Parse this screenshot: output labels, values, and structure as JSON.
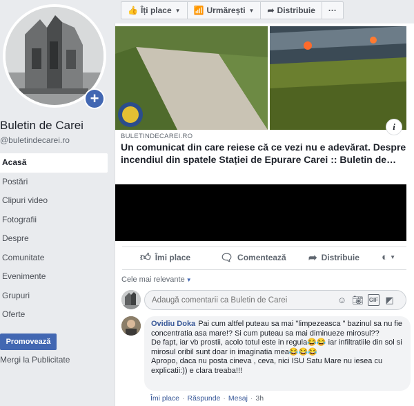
{
  "page": {
    "name": "Buletin de Carei",
    "handle": "@buletindecarei.ro"
  },
  "nav": [
    {
      "label": "Acasă",
      "active": true
    },
    {
      "label": "Postări"
    },
    {
      "label": "Clipuri video"
    },
    {
      "label": "Fotografii"
    },
    {
      "label": "Despre"
    },
    {
      "label": "Comunitate"
    },
    {
      "label": "Evenimente"
    },
    {
      "label": "Grupuri"
    },
    {
      "label": "Oferte"
    }
  ],
  "promote_label": "Promovează",
  "publicity_label": "Mergi la Publicitate",
  "action_bar": {
    "like": "Îți place",
    "follow": "Urmărești",
    "share": "Distribuie",
    "more": "···"
  },
  "link": {
    "domain": "BULETINDECAREI.RO",
    "title": "Un comunicat din care reiese că ce vezi nu e adevărat. Despre incendiul din spatele Stației de Epurare Carei :: Buletin de…"
  },
  "reactions": {
    "like": "Îmi place",
    "comment": "Comentează",
    "share": "Distribuie"
  },
  "comments": {
    "sort_label": "Cele mai relevante",
    "input_placeholder": "Adaugă comentarii ca Buletin de Carei",
    "first": {
      "author": "Ovidiu Doka",
      "line1": "Pai cum altfel puteau sa mai \"limpezeasca \" bazinul sa nu fie concentratia asa mare!? Si cum puteau sa mai diminueze mirosul??",
      "line2": "De fapt, iar vb prostii, acolo totul este in regula😂😂 iar infiltratiile din sol si mirosul oribil sunt doar in imaginatia mea😂😂😂",
      "line3": "Apropo, daca nu posta cineva , ceva, nici ISU Satu Mare nu iesea cu explicatii:)) e clara treaba!!!",
      "like": "Îmi place",
      "reply": "Răspunde",
      "message": "Mesaj",
      "time": "3h"
    }
  },
  "colors": {
    "brand": "#4267b2",
    "link": "#385898",
    "background": "#e9ebee"
  }
}
